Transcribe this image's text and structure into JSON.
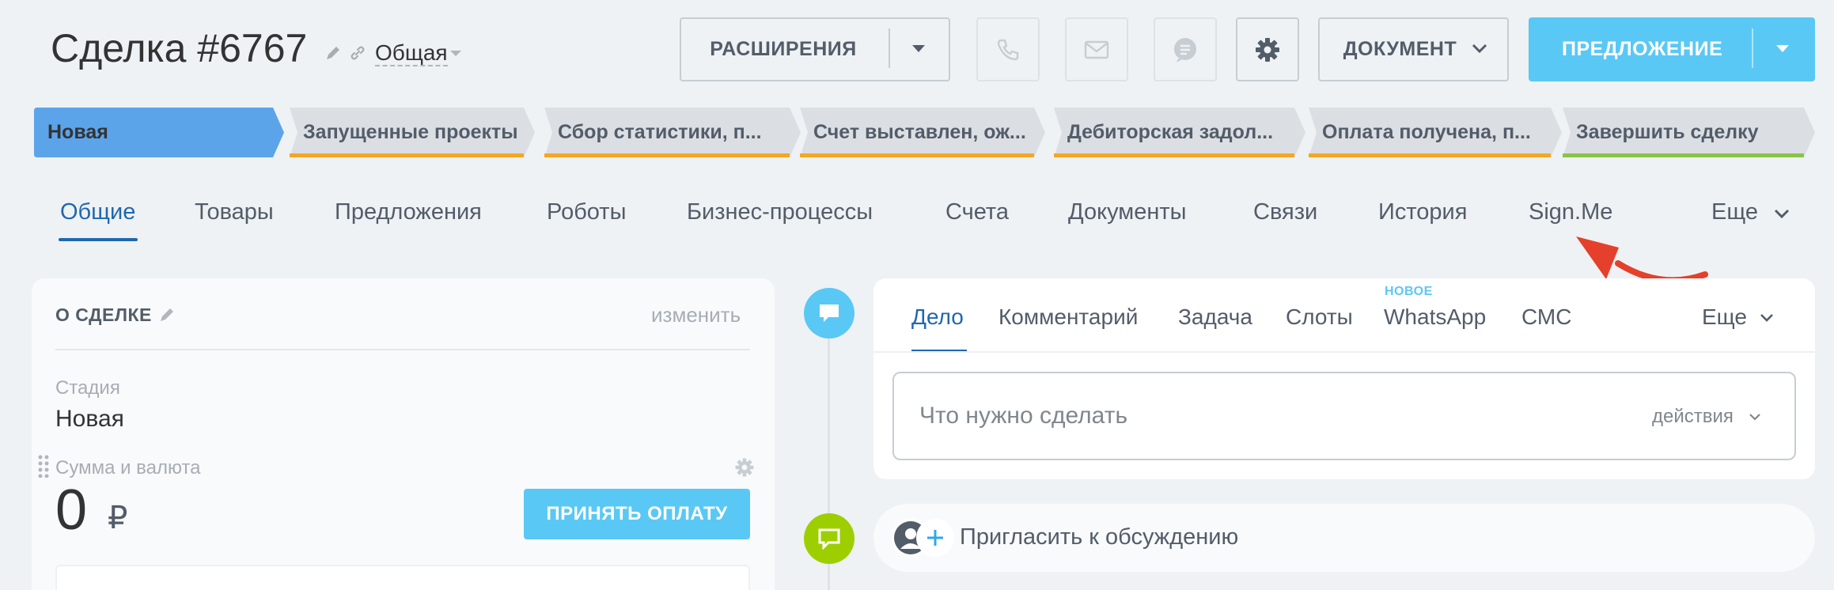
{
  "header": {
    "title": "Сделка #6767",
    "category": "Общая",
    "extensions_label": "РАСШИРЕНИЯ",
    "document_label": "ДОКУМЕНТ",
    "offer_label": "ПРЕДЛОЖЕНИЕ"
  },
  "stages": [
    {
      "label": "Новая",
      "color": "#5ba4ea",
      "active": true
    },
    {
      "label": "Запущенные проекты",
      "color": "#f5a623"
    },
    {
      "label": "Сбор статистики, п...",
      "color": "#f5a623"
    },
    {
      "label": "Счет выставлен, ож...",
      "color": "#f5a623"
    },
    {
      "label": "Дебиторская задол...",
      "color": "#f5a623"
    },
    {
      "label": "Оплата получена, п...",
      "color": "#f5a623"
    },
    {
      "label": "Завершить сделку",
      "color": "#8bc34a"
    }
  ],
  "main_tabs": [
    {
      "label": "Общие",
      "active": true
    },
    {
      "label": "Товары"
    },
    {
      "label": "Предложения"
    },
    {
      "label": "Роботы"
    },
    {
      "label": "Бизнес-процессы"
    },
    {
      "label": "Счета"
    },
    {
      "label": "Документы"
    },
    {
      "label": "Связи"
    },
    {
      "label": "История"
    },
    {
      "label": "Sign.Me"
    },
    {
      "label": "Еще"
    }
  ],
  "deal_card": {
    "title": "О СДЕЛКЕ",
    "edit_label": "изменить",
    "stage_label": "Стадия",
    "stage_value": "Новая",
    "sum_label": "Сумма и валюта",
    "sum_value": "0",
    "currency": "₽",
    "pay_button": "ПРИНЯТЬ ОПЛАТУ"
  },
  "activity": {
    "tabs": [
      {
        "label": "Дело",
        "active": true
      },
      {
        "label": "Комментарий"
      },
      {
        "label": "Задача"
      },
      {
        "label": "Слоты"
      },
      {
        "label": "WhatsApp",
        "badge": "НОВОЕ"
      },
      {
        "label": "СМС"
      },
      {
        "label": "Еще"
      }
    ],
    "input_placeholder": "Что нужно сделать",
    "actions_label": "действия",
    "invite_label": "Пригласить к обсуждению"
  },
  "colors": {
    "accent": "#2067b0",
    "primary_button": "#5ac8f5",
    "annotation_arrow": "#e5402b"
  }
}
